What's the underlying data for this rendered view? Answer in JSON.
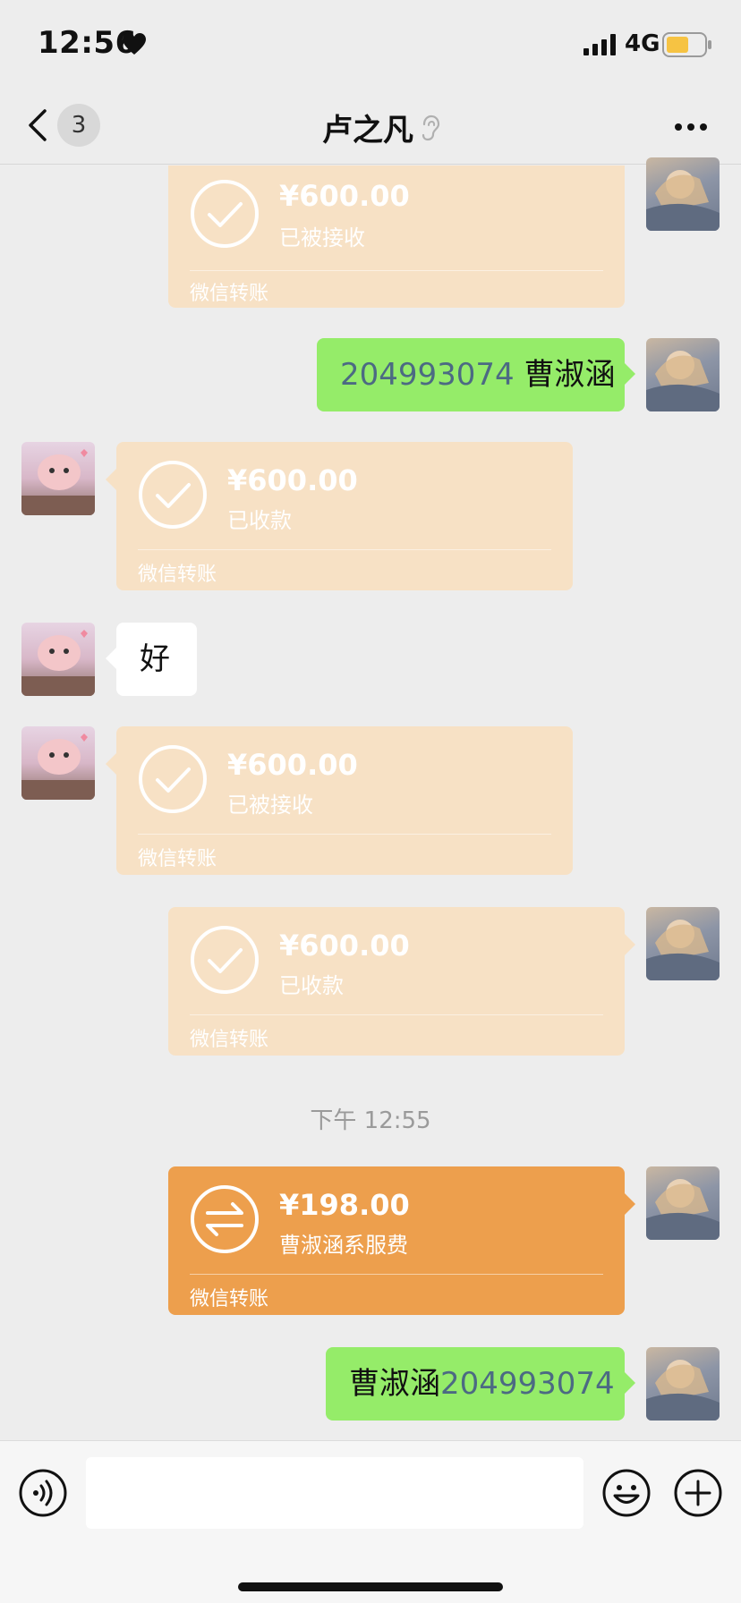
{
  "status_bar": {
    "time": "12:56",
    "network": "4G",
    "icons": [
      "heart-icon",
      "signal-icon",
      "battery-icon"
    ],
    "battery_color": "#f6c343"
  },
  "nav": {
    "back_icon": "chevron-left-icon",
    "unread_count": "3",
    "title": "卢之凡",
    "title_icon": "ear-icon",
    "more_icon": "more-dots-icon"
  },
  "colors": {
    "chat_background": "#ededed",
    "self_bubble": "#95ec69",
    "other_bubble": "#ffffff",
    "transfer_done": "#f7e1c5",
    "transfer_pending": "#ed9f4d",
    "number_link": "#4c6a83"
  },
  "messages": [
    {
      "sender": "self",
      "type": "transfer",
      "amount": "¥600.00",
      "status": "已被接收",
      "label": "微信转账",
      "icon": "check-circle-icon"
    },
    {
      "sender": "self",
      "type": "text",
      "number": "204993074",
      "text": " 曹淑涵"
    },
    {
      "sender": "other",
      "type": "transfer",
      "amount": "¥600.00",
      "status": "已收款",
      "label": "微信转账",
      "icon": "check-circle-icon"
    },
    {
      "sender": "other",
      "type": "text",
      "text": "好"
    },
    {
      "sender": "other",
      "type": "transfer",
      "amount": "¥600.00",
      "status": "已被接收",
      "label": "微信转账",
      "icon": "check-circle-icon"
    },
    {
      "sender": "self",
      "type": "transfer",
      "amount": "¥600.00",
      "status": "已收款",
      "label": "微信转账",
      "icon": "check-circle-icon"
    },
    {
      "type": "timestamp",
      "text": "下午 12:55"
    },
    {
      "sender": "self",
      "type": "transfer",
      "amount": "¥198.00",
      "status": "曹淑涵系服费",
      "label": "微信转账",
      "icon": "transfer-arrows-icon"
    },
    {
      "sender": "self",
      "type": "text",
      "text": "曹淑涵",
      "number": "204993074"
    }
  ],
  "input_bar": {
    "voice_icon": "voice-icon",
    "input_value": "",
    "emoji_icon": "emoji-icon",
    "plus_icon": "plus-icon"
  }
}
